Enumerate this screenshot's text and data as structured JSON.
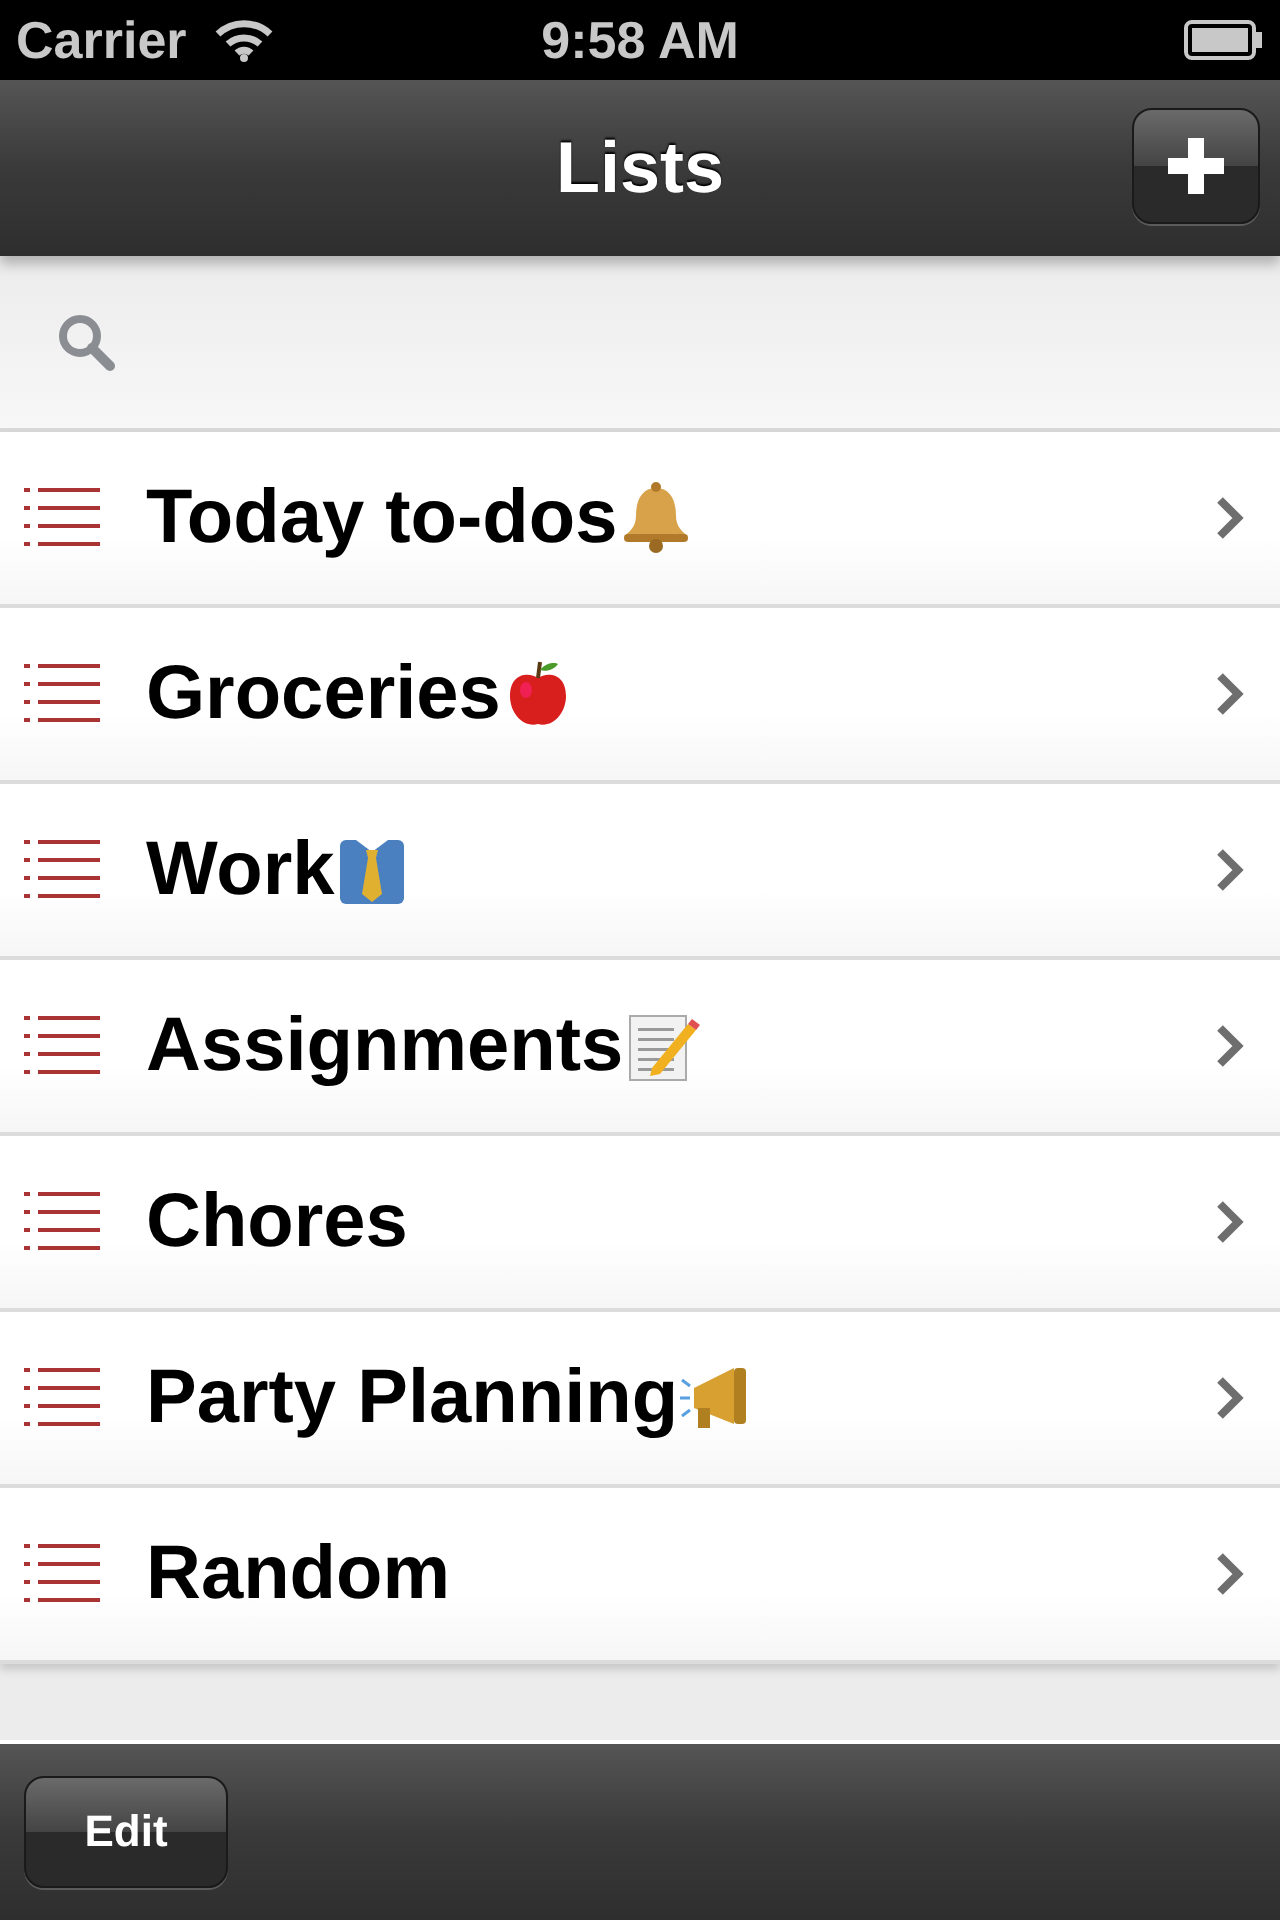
{
  "status_bar": {
    "carrier": "Carrier",
    "time": "9:58 AM"
  },
  "nav_bar": {
    "title": "Lists"
  },
  "lists": [
    {
      "title": "Today to-dos",
      "kind": "bell"
    },
    {
      "title": "Groceries",
      "kind": "apple"
    },
    {
      "title": "Work",
      "kind": "necktie"
    },
    {
      "title": "Assignments",
      "kind": "memo"
    },
    {
      "title": "Chores",
      "kind": "plain"
    },
    {
      "title": "Party Planning",
      "kind": "megaphone"
    },
    {
      "title": "Random",
      "kind": "plain"
    }
  ],
  "toolbar": {
    "edit_button": "Edit"
  }
}
